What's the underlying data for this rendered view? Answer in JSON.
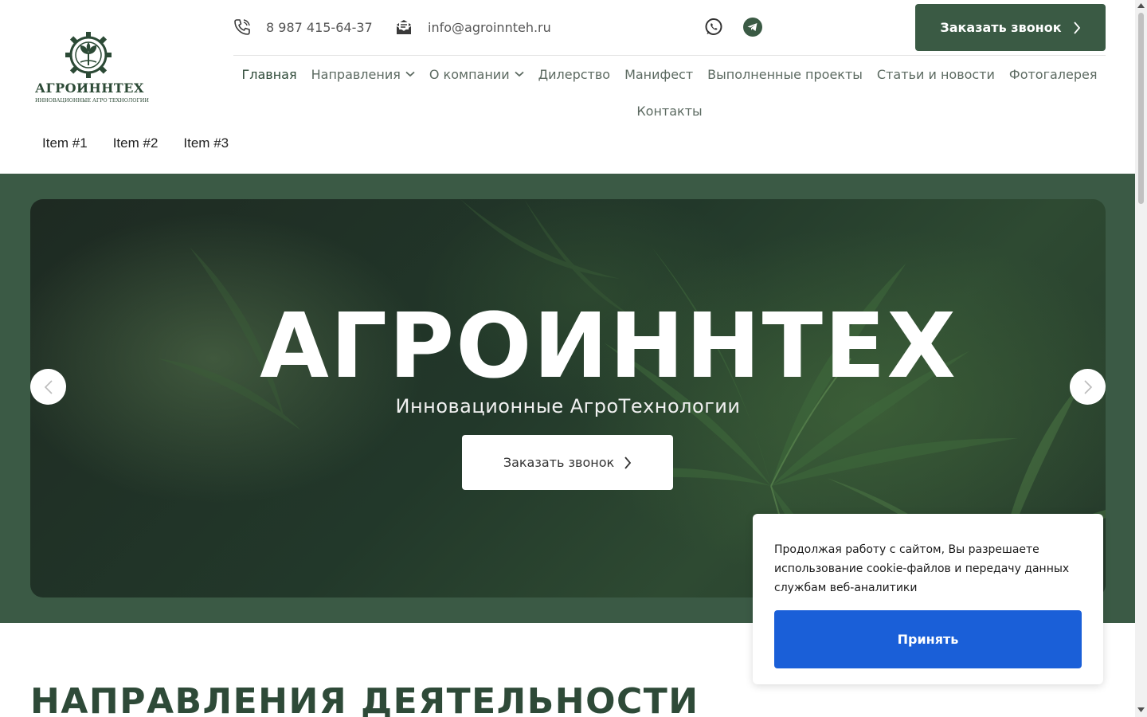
{
  "brand": {
    "name": "АГРОИННТЕХ",
    "tagline": "ИННОВАЦИОННЫЕ АГРО ТЕХНОЛОГИИ"
  },
  "header": {
    "phone": "8 987 415-64-37",
    "email": "info@agroinnteh.ru",
    "call_button": "Заказать звонок",
    "icons": {
      "phone": "phone-icon",
      "email": "email-icon",
      "whatsapp": "whatsapp-icon",
      "telegram": "telegram-icon"
    }
  },
  "nav": {
    "items": [
      {
        "label": "Главная"
      },
      {
        "label": "Направления"
      },
      {
        "label": "О компании"
      },
      {
        "label": "Дилерство"
      },
      {
        "label": "Манифест"
      },
      {
        "label": "Выполненные проекты"
      },
      {
        "label": "Статьи и новости"
      },
      {
        "label": "Фотогалерея"
      },
      {
        "label": "Контакты"
      }
    ]
  },
  "sub_menu": {
    "items": [
      "Item #1",
      "Item #2",
      "Item #3"
    ]
  },
  "hero": {
    "title": "АГРОИННТЕХ",
    "subtitle": "Инновационные АгроТехнологии",
    "button": "Заказать звонок"
  },
  "section": {
    "title": "НАПРАВЛЕНИЯ ДЕЯТЕЛЬНОСТИ"
  },
  "cookie": {
    "text": "Продолжая работу с сайтом, Вы разрешаете использование cookie-файлов и передачу данных службам веб-аналитики",
    "accept": "Принять"
  },
  "colors": {
    "brand_green": "#3a5a44",
    "hero_band": "#3b5a45",
    "accept_blue": "#1a5fd8"
  }
}
